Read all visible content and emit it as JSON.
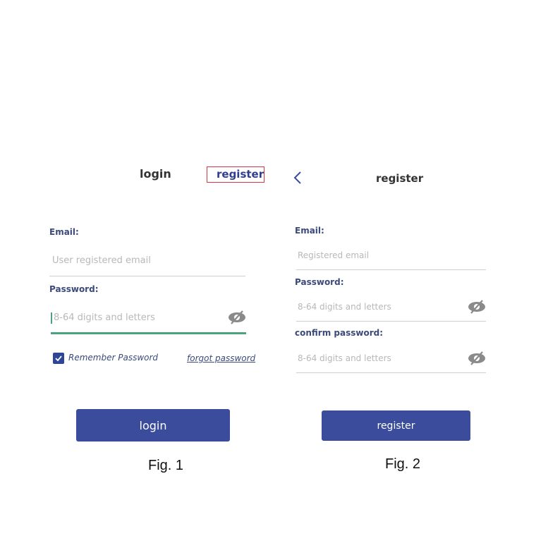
{
  "fig1": {
    "tabs": {
      "login_label": "login",
      "register_label": "register"
    },
    "email": {
      "label": "Email:",
      "placeholder": "User registered email"
    },
    "password": {
      "label": "Password:",
      "placeholder": "8-64 digits and letters"
    },
    "remember_label": "Remember Password",
    "forgot_label": "forgot password",
    "login_button_label": "login",
    "caption": "Fig. 1"
  },
  "fig2": {
    "title": "register",
    "email": {
      "label": "Email:",
      "placeholder": "Registered email"
    },
    "password": {
      "label": "Password:",
      "placeholder": "8-64 digits and letters"
    },
    "confirm": {
      "label": "confirm password:",
      "placeholder": "8-64 digits and letters"
    },
    "register_button_label": "register",
    "caption": "Fig. 2"
  },
  "icons": [
    "eye-off-icon",
    "checkmark-icon",
    "back-chevron-icon"
  ],
  "colors": {
    "primary": "#3a4c9b",
    "highlight_box": "#d9363e",
    "focus_line": "#4aa37e"
  }
}
